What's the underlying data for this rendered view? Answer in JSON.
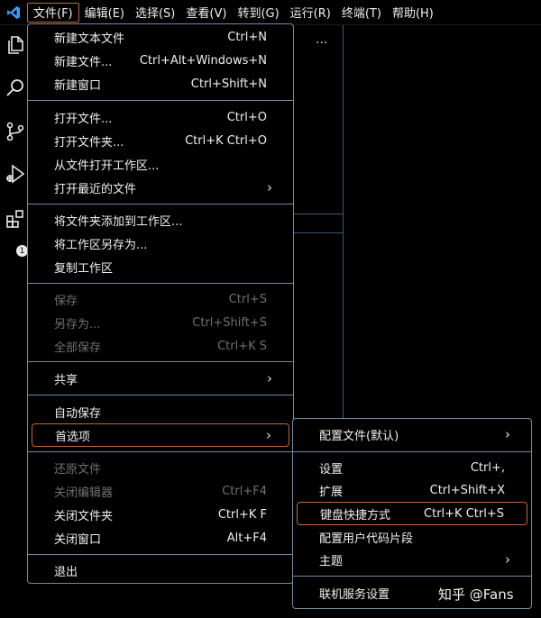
{
  "menubar": {
    "items": [
      {
        "label": "文件(F)"
      },
      {
        "label": "编辑(E)"
      },
      {
        "label": "选择(S)"
      },
      {
        "label": "查看(V)"
      },
      {
        "label": "转到(G)"
      },
      {
        "label": "运行(R)"
      },
      {
        "label": "终端(T)"
      },
      {
        "label": "帮助(H)"
      }
    ]
  },
  "activity_bar": {
    "icons": [
      "explorer-icon",
      "search-icon",
      "source-control-icon",
      "run-debug-icon",
      "extensions-icon"
    ],
    "extensions_badge": "1"
  },
  "editor": {
    "more_actions": "..."
  },
  "file_menu": {
    "new_text_file": {
      "label": "新建文本文件",
      "shortcut": "Ctrl+N"
    },
    "new_file": {
      "label": "新建文件...",
      "shortcut": "Ctrl+Alt+Windows+N"
    },
    "new_window": {
      "label": "新建窗口",
      "shortcut": "Ctrl+Shift+N"
    },
    "open_file": {
      "label": "打开文件...",
      "shortcut": "Ctrl+O"
    },
    "open_folder": {
      "label": "打开文件夹...",
      "shortcut": "Ctrl+K Ctrl+O"
    },
    "open_workspace": {
      "label": "从文件打开工作区..."
    },
    "open_recent": {
      "label": "打开最近的文件"
    },
    "add_folder": {
      "label": "将文件夹添加到工作区..."
    },
    "save_workspace_as": {
      "label": "将工作区另存为..."
    },
    "duplicate_workspace": {
      "label": "复制工作区"
    },
    "save": {
      "label": "保存",
      "shortcut": "Ctrl+S"
    },
    "save_as": {
      "label": "另存为...",
      "shortcut": "Ctrl+Shift+S"
    },
    "save_all": {
      "label": "全部保存",
      "shortcut": "Ctrl+K S"
    },
    "share": {
      "label": "共享"
    },
    "auto_save": {
      "label": "自动保存"
    },
    "preferences": {
      "label": "首选项"
    },
    "revert_file": {
      "label": "还原文件"
    },
    "close_editor": {
      "label": "关闭编辑器",
      "shortcut": "Ctrl+F4"
    },
    "close_folder": {
      "label": "关闭文件夹",
      "shortcut": "Ctrl+K F"
    },
    "close_window": {
      "label": "关闭窗口",
      "shortcut": "Alt+F4"
    },
    "exit": {
      "label": "退出"
    }
  },
  "preferences_menu": {
    "profiles": {
      "label": "配置文件(默认)"
    },
    "settings": {
      "label": "设置",
      "shortcut": "Ctrl+,"
    },
    "extensions": {
      "label": "扩展",
      "shortcut": "Ctrl+Shift+X"
    },
    "keyboard_shortcuts": {
      "label": "键盘快捷方式",
      "shortcut": "Ctrl+K Ctrl+S"
    },
    "user_snippets": {
      "label": "配置用户代码片段"
    },
    "theme": {
      "label": "主题"
    },
    "online_services": {
      "label": "联机服务设置"
    }
  },
  "watermark": "知乎 @Fans",
  "colors": {
    "background": "#000000",
    "menu_border": "#6f8ba3",
    "highlight_border": "#c8643c",
    "disabled_text": "#707070",
    "vscode_blue": "#3b9cff"
  }
}
